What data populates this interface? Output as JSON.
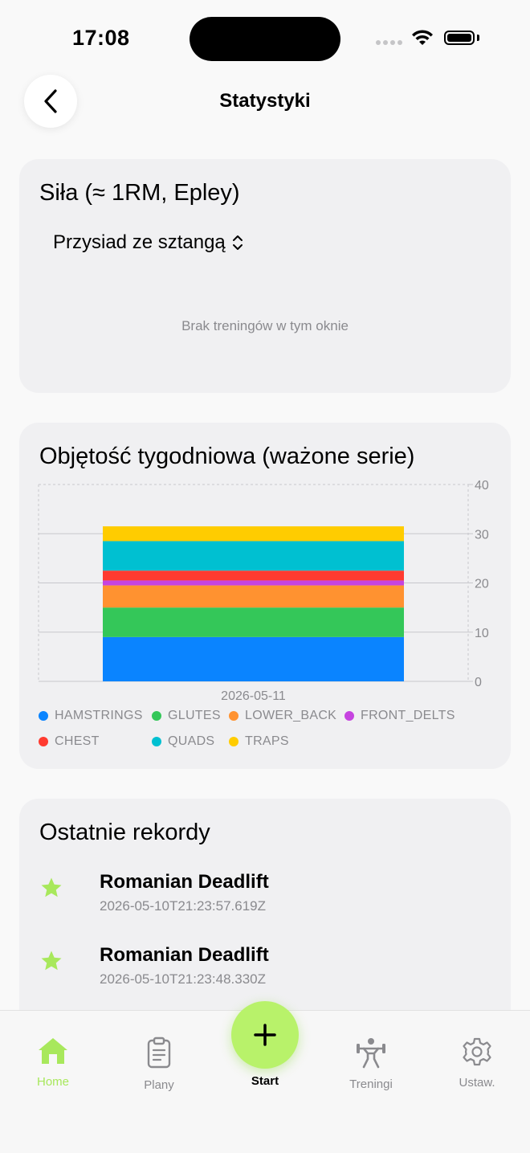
{
  "status": {
    "time": "17:08"
  },
  "header": {
    "title": "Statystyki"
  },
  "strength": {
    "title": "Siła (≈ 1RM, Epley)",
    "selected_exercise": "Przysiad ze sztangą",
    "empty_message": "Brak treningów w tym oknie"
  },
  "volume": {
    "title": "Objętość tygodniowa (ważone serie)",
    "legend": [
      {
        "label": "HAMSTRINGS",
        "color": "#0a84ff"
      },
      {
        "label": "GLUTES",
        "color": "#34c759"
      },
      {
        "label": "LOWER_BACK",
        "color": "#ff9230"
      },
      {
        "label": "FRONT_DELTS",
        "color": "#c644e0"
      },
      {
        "label": "CHEST",
        "color": "#ff3b30"
      },
      {
        "label": "QUADS",
        "color": "#00c0d1"
      },
      {
        "label": "TRAPS",
        "color": "#ffcc00"
      }
    ]
  },
  "chart_data": {
    "type": "bar",
    "stacked": true,
    "categories": [
      "2026-05-11"
    ],
    "series": [
      {
        "name": "HAMSTRINGS",
        "values": [
          9
        ],
        "color": "#0a84ff"
      },
      {
        "name": "GLUTES",
        "values": [
          6
        ],
        "color": "#34c759"
      },
      {
        "name": "LOWER_BACK",
        "values": [
          4.5
        ],
        "color": "#ff9230"
      },
      {
        "name": "FRONT_DELTS",
        "values": [
          1
        ],
        "color": "#c644e0"
      },
      {
        "name": "CHEST",
        "values": [
          2
        ],
        "color": "#ff3b30"
      },
      {
        "name": "QUADS",
        "values": [
          6
        ],
        "color": "#00c0d1"
      },
      {
        "name": "TRAPS",
        "values": [
          3
        ],
        "color": "#ffcc00"
      }
    ],
    "yticks": [
      "0",
      "10",
      "20",
      "30",
      "40"
    ],
    "ylim": [
      0,
      40
    ],
    "y_axis_side": "right",
    "grid": true
  },
  "records": {
    "title": "Ostatnie rekordy",
    "items": [
      {
        "name": "Romanian Deadlift",
        "date": "2026-05-10T21:23:57.619Z"
      },
      {
        "name": "Romanian Deadlift",
        "date": "2026-05-10T21:23:48.330Z"
      }
    ]
  },
  "tabbar": {
    "home": "Home",
    "plans": "Plany",
    "start": "Start",
    "workouts": "Treningi",
    "settings": "Ustaw."
  },
  "colors": {
    "accent": "#b8f26a",
    "home_active": "#a8e85c"
  }
}
